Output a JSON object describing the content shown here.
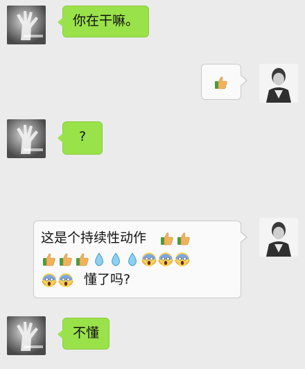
{
  "messages": [
    {
      "side": "left",
      "text": "你在干嘛。"
    },
    {
      "side": "right",
      "emoji": [
        "thumbs-up"
      ]
    },
    {
      "side": "left",
      "text": "?"
    },
    {
      "side": "right",
      "line1_text": "这是个持续性动作",
      "line1_emoji": [
        "thumbs-up",
        "thumbs-up"
      ],
      "line2_emoji": [
        "thumbs-up",
        "thumbs-up",
        "thumbs-up",
        "droplet",
        "droplet",
        "droplet",
        "scream",
        "scream",
        "scream"
      ],
      "line3_emoji": [
        "scream",
        "scream"
      ],
      "line3_text": "懂了吗?"
    },
    {
      "side": "left",
      "text": "不懂"
    }
  ],
  "colors": {
    "background": "#ebebeb",
    "sent_bubble": "#fafafa",
    "received_bubble": "#9ae24a"
  }
}
